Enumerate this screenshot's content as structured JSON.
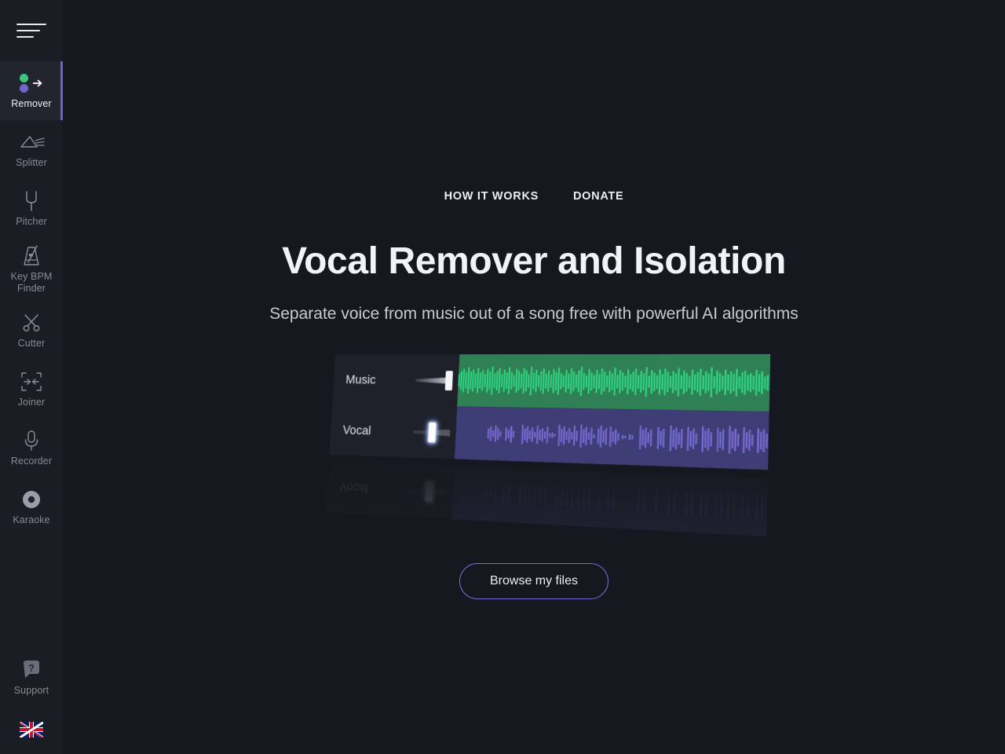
{
  "colors": {
    "page_bg": "#16181f",
    "sidebar_bg": "#1b1d25",
    "active_item_bg": "#22242e",
    "accent_purple": "#6d5fd0",
    "button_border": "#7b68d9",
    "music_track_bg": "#2f8055",
    "music_wave": "#2ee88a",
    "vocal_track_bg": "#3f3d75",
    "vocal_wave": "#7d6fdd",
    "label_gray": "#878a96",
    "text_light": "#f2f3f6"
  },
  "sidebar": {
    "menu_button": "menu",
    "items": [
      {
        "id": "remover",
        "label": "Remover",
        "icon": "two-dots-arrow-icon",
        "active": true
      },
      {
        "id": "splitter",
        "label": "Splitter",
        "icon": "prism-icon",
        "active": false
      },
      {
        "id": "pitcher",
        "label": "Pitcher",
        "icon": "tuning-fork-icon",
        "active": false
      },
      {
        "id": "keybpm",
        "label": "Key BPM Finder",
        "icon": "metronome-icon",
        "active": false
      },
      {
        "id": "cutter",
        "label": "Cutter",
        "icon": "scissors-icon",
        "active": false
      },
      {
        "id": "joiner",
        "label": "Joiner",
        "icon": "join-arrows-icon",
        "active": false
      },
      {
        "id": "recorder",
        "label": "Recorder",
        "icon": "microphone-icon",
        "active": false
      },
      {
        "id": "karaoke",
        "label": "Karaoke",
        "icon": "record-disc-icon",
        "active": false
      }
    ],
    "support": {
      "label": "Support",
      "icon": "question-bubble-icon"
    },
    "language": {
      "icon": "uk-flag-icon",
      "name": "English"
    }
  },
  "topnav": {
    "links": [
      {
        "id": "how-it-works",
        "label": "HOW IT WORKS"
      },
      {
        "id": "donate",
        "label": "DONATE"
      }
    ]
  },
  "hero": {
    "title": "Vocal Remover and Isolation",
    "subtitle": "Separate voice from music out of a song free with powerful AI algorithms"
  },
  "illustration": {
    "tracks": [
      {
        "id": "music",
        "label": "Music",
        "slider_position": "max",
        "wave_color": "#2ee88a",
        "bg_color": "#2f8055"
      },
      {
        "id": "vocal",
        "label": "Vocal",
        "slider_position": "mid",
        "wave_color": "#7d6fdd",
        "bg_color": "#3f3d75"
      }
    ],
    "reflection_label": "Vocal"
  },
  "actions": {
    "browse_button": "Browse my files"
  }
}
